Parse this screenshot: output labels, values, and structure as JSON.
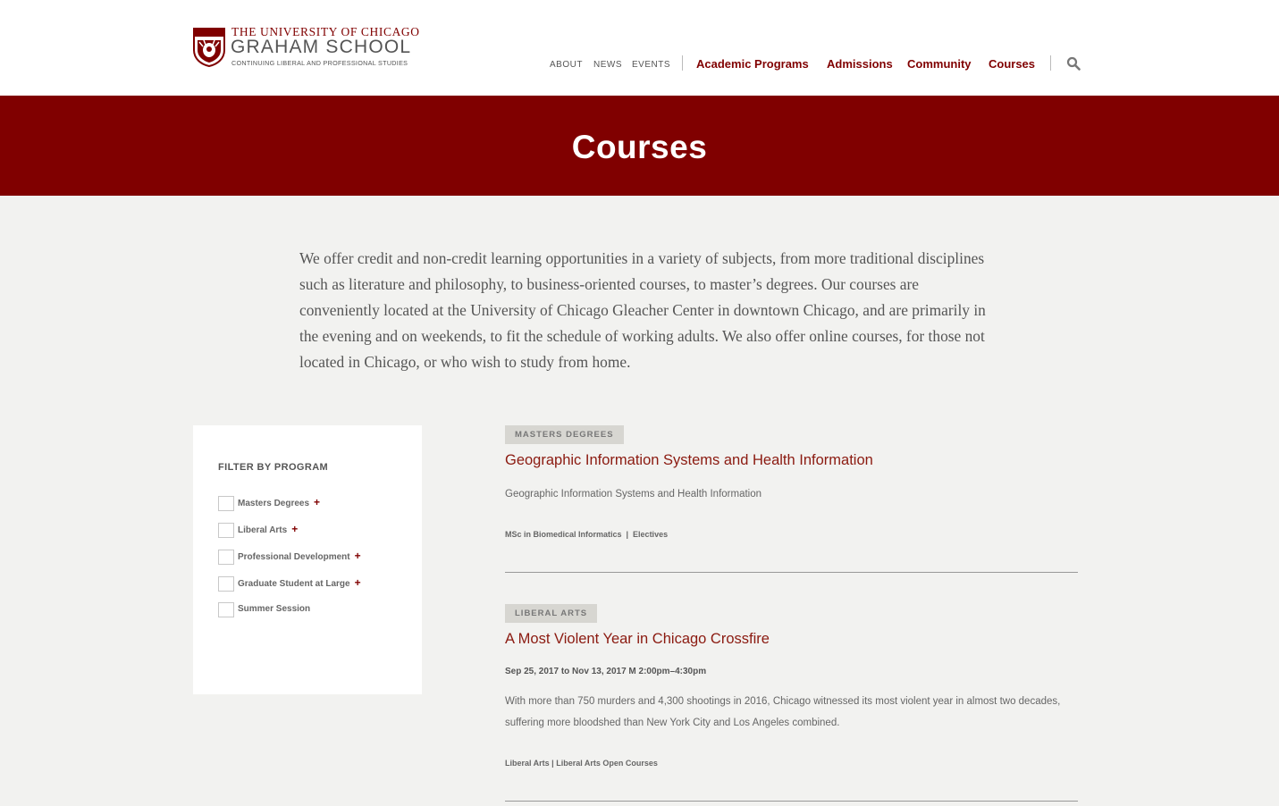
{
  "header": {
    "logo": {
      "line1": "THE UNIVERSITY OF CHICAGO",
      "line2": "GRAHAM SCHOOL",
      "line3": "CONTINUING LIBERAL AND PROFESSIONAL STUDIES"
    },
    "utility_nav": [
      "ABOUT",
      "NEWS",
      "EVENTS"
    ],
    "main_nav": [
      "Academic Programs",
      "Admissions",
      "Community",
      "Courses"
    ],
    "search_icon": "search-icon"
  },
  "banner": {
    "title": "Courses"
  },
  "intro": "We offer credit and non-credit learning opportunities in a variety of subjects, from more traditional disciplines such as literature and philosophy, to business-oriented courses, to master’s degrees. Our courses are conveniently located at the University of Chicago Gleacher Center in downtown Chicago, and are primarily in the evening and on weekends, to fit the schedule of working adults. We also offer online courses, for those not located in Chicago, or who wish to study from home.",
  "filter": {
    "title": "FILTER BY PROGRAM",
    "items": [
      {
        "label": "Masters Degrees",
        "expandable": true
      },
      {
        "label": "Liberal Arts",
        "expandable": true
      },
      {
        "label": "Professional Development",
        "expandable": true
      },
      {
        "label": "Graduate Student at Large",
        "expandable": true
      },
      {
        "label": "Summer Session",
        "expandable": false
      }
    ]
  },
  "courses": [
    {
      "tag": "MASTERS DEGREES",
      "title": "Geographic Information Systems and Health Information",
      "description": "Geographic Information Systems and Health Information",
      "meta": "MSc in Biomedical Informatics  |  Electives"
    },
    {
      "tag": "LIBERAL ARTS",
      "title": "A Most Violent Year in Chicago Crossfire",
      "date": "Sep 25, 2017 to Nov 13, 2017 M 2:00pm–4:30pm",
      "description": "With more than 750 murders and 4,300 shootings in 2016, Chicago witnessed its most violent year in almost two decades, suffering more bloodshed than New York City and Los Angeles combined.",
      "meta": "Liberal Arts | Liberal Arts Open Courses"
    }
  ],
  "colors": {
    "maroon": "#800000",
    "page_bg": "#f2f2f0",
    "tag_bg": "#d7d6d1"
  }
}
